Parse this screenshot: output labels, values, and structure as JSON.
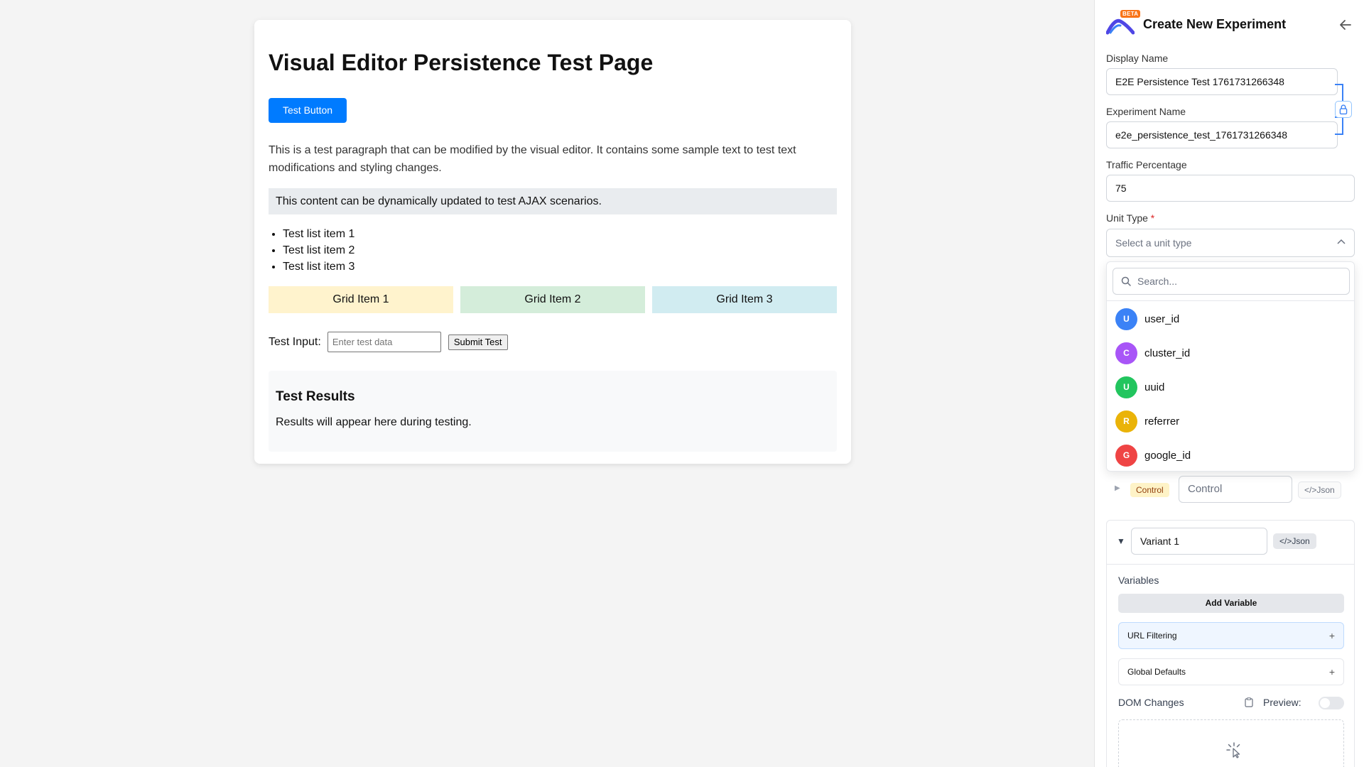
{
  "test_page": {
    "title": "Visual Editor Persistence Test Page",
    "button_label": "Test Button",
    "paragraph": "This is a test paragraph that can be modified by the visual editor. It contains some sample text to test text modifications and styling changes.",
    "dynamic_content": "This content can be dynamically updated to test AJAX scenarios.",
    "list_items": [
      "Test list item 1",
      "Test list item 2",
      "Test list item 3"
    ],
    "grid_items": [
      {
        "label": "Grid Item 1",
        "color": "#fff3cd"
      },
      {
        "label": "Grid Item 2",
        "color": "#d4edda"
      },
      {
        "label": "Grid Item 3",
        "color": "#d1ecf1"
      }
    ],
    "input_label": "Test Input:",
    "input_placeholder": "Enter test data",
    "submit_label": "Submit Test",
    "results_title": "Test Results",
    "results_text": "Results will appear here during testing."
  },
  "panel": {
    "beta_badge": "BETA",
    "title": "Create New Experiment",
    "display_name_label": "Display Name",
    "display_name_value": "E2E Persistence Test 1761731266348",
    "experiment_name_label": "Experiment Name",
    "experiment_name_value": "e2e_persistence_test_1761731266348",
    "traffic_label": "Traffic Percentage",
    "traffic_value": "75",
    "unit_type_label": "Unit Type",
    "required_mark": "*",
    "unit_type_placeholder": "Select a unit type",
    "search_placeholder": "Search...",
    "unit_options": [
      {
        "initial": "U",
        "label": "user_id",
        "color": "#3b82f6"
      },
      {
        "initial": "C",
        "label": "cluster_id",
        "color": "#a855f7"
      },
      {
        "initial": "U",
        "label": "uuid",
        "color": "#22c55e"
      },
      {
        "initial": "R",
        "label": "referrer",
        "color": "#eab308"
      },
      {
        "initial": "G",
        "label": "google_id",
        "color": "#ef4444"
      }
    ],
    "control_badge": "Control",
    "control_value": "Control",
    "json_label": "</>Json",
    "variant_value": "Variant 1",
    "variables_label": "Variables",
    "add_variable_label": "Add Variable",
    "url_filtering_label": "URL Filtering",
    "global_defaults_label": "Global Defaults",
    "dom_changes_label": "DOM Changes",
    "preview_label": "Preview:",
    "accent_color": "#3b82f6"
  }
}
